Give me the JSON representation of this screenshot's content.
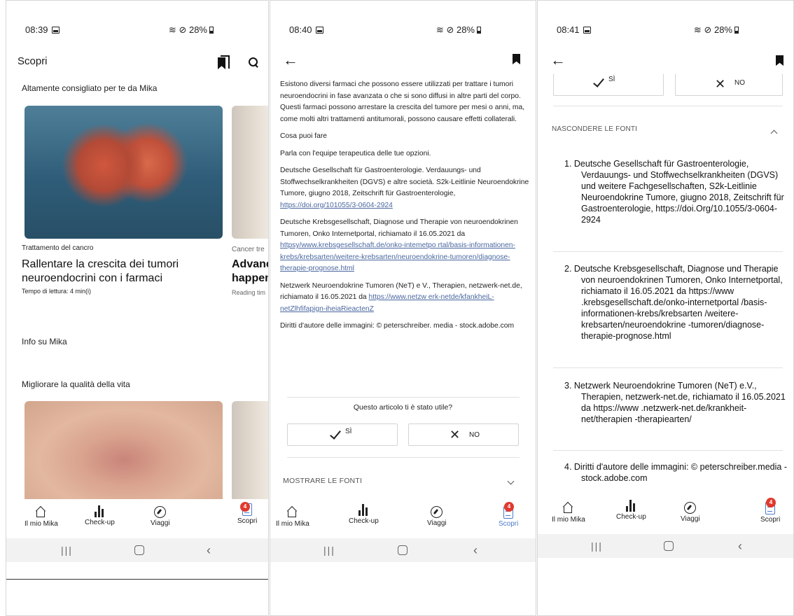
{
  "colors": {
    "accent": "#4a7bc8",
    "badge": "#e03a2f",
    "link": "#4a67a0",
    "system_bar": "#f2f2f2"
  },
  "status": {
    "s1": {
      "time": "08:39",
      "battery": "28%"
    },
    "s2": {
      "time": "08:40",
      "battery": "28%"
    },
    "s3": {
      "time": "08:41",
      "battery": "28%"
    }
  },
  "screen1": {
    "title": "Scopri",
    "section_recommended": "Altamente consigliato per te da Mika",
    "card1": {
      "category": "Trattamento del cancro",
      "title": "Rallentare la crescita dei tumori neuroendocrini con i farmaci",
      "meta": "Tempo di lettura: 4 min(i)"
    },
    "card2": {
      "category": "Cancer tre",
      "title_l1": "Advanc",
      "title_l2": "happen",
      "meta": "Reading tim"
    },
    "section_info": "Info su Mika",
    "section_quality": "Migliorare la qualità della vita"
  },
  "screen2": {
    "p1": "Esistono diversi farmaci che possono essere utilizzati per trattare i tumori neuroendocrini in fase avanzata o che si sono diffusi in altre parti del corpo. Questi farmaci possono arrestare la crescita del tumore per mesi o anni, ma, come molti altri trattamenti antitumorali, possono causare effetti collaterali.",
    "p2": "Cosa puoi fare",
    "p3": "Parla con l'equipe terapeutica delle tue opzioni.",
    "p4_text": "Deutsche Gesellschaft für Gastroenterologie. Verdauungs- und Stoffwechselkrankheiten (DGVS) e altre società. S2k-Leitlinie Neuroendokrine Tumore, giugno 2018, Zeitschrift für Gastroenterologie,",
    "p4_link": "https://doi.org/101055/3-0604-2924",
    "p5_text": "Deutsche Krebsgesellschaft, Diagnose und Therapie von neuroendokrinen Tumoren, Onko Internetportal, richiamato il 16.05.2021 da",
    "p5_link": "httpsy/www.krebsgesellschaft.de/onko-intemetpo rtal/basis-informationen-krebs/krebsarten/weitere-krebsarten/neuroendokrine-tumoren/diagnose-therapie-prognose.html",
    "p6_text": "Netzwerk Neuroendokrine Tumoren (NeT) e V., Therapien, netzwerk-net.de, richiamato il 16.05.2021 da",
    "p6_link": "https://www.netzw erk-netde/kfankheiL-netZlhfifapign-iheiaRieactenZ",
    "p7": "Diritti d'autore delle immagini: © peterschreiber. media - stock.adobe.com",
    "question": "Questo articolo ti è stato utile?",
    "yes": "SÌ",
    "no": "NO",
    "show_sources": "MOSTRARE LE FONTI"
  },
  "screen3": {
    "yes": "SÌ",
    "no": "NO",
    "hide_sources": "NASCONDERE LE FONTI",
    "sources": [
      "1. Deutsche Gesellschaft für Gastroenterologie, Verdauungs- und Stoffwechselkrankheiten (DGVS) und weitere Fachgesellschaften, S2k-Leitlinie Neuroendokrine Tumore, giugno 2018, Zeitschrift für Gastroenterologie, https://doi.Org/10.1055/3-0604-2924",
      "2. Deutsche Krebsgesellschaft, Diagnose und Therapie von neuroendokrinen Tumoren, Onko Internetportal, richiamato il 16.05.2021 da https://www .krebsgesellschaft.de/onko-internetportal /basis-informationen-krebs/krebsarten /weitere-krebsarten/neuroendokrine -tumoren/diagnose-therapie-prognose.html",
      "3. Netzwerk Neuroendokrine Tumoren (NeT) e.V., Therapien, netzwerk-net.de, richiamato il 16.05.2021 da https://www .netzwerk-net.de/krankheit-net/therapien -therapiearten/",
      "4. Diritti d'autore delle immagini: © peterschreiber.media - stock.adobe.com"
    ]
  },
  "nav": {
    "home": "Il mio Mika",
    "checkup": "Check-up",
    "travel": "Viaggi",
    "discover": "Scopri",
    "badge_count": "4"
  },
  "icons": [
    "bookmark-icon",
    "search-icon",
    "back-arrow-icon",
    "home-icon",
    "bar-chart-icon",
    "compass-icon",
    "document-icon",
    "check-icon",
    "x-icon",
    "chevron-icon"
  ]
}
